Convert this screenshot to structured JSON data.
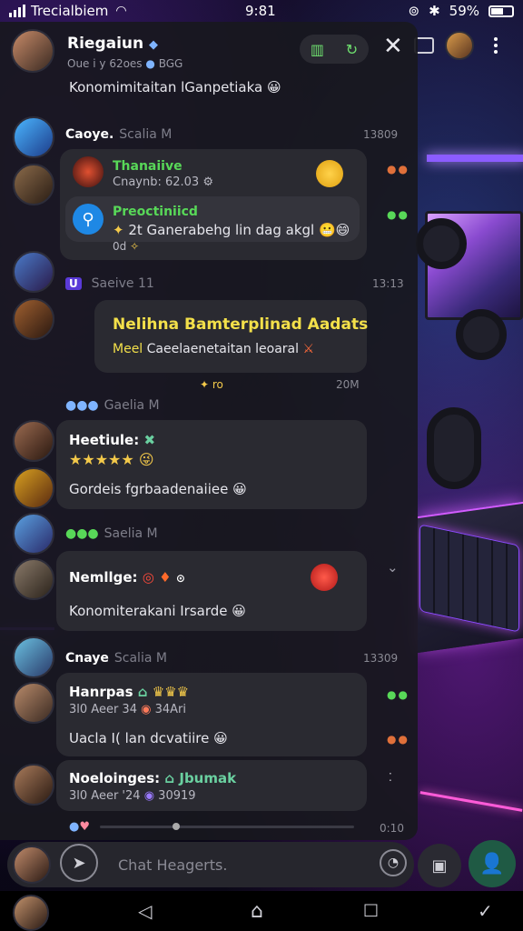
{
  "status_bar": {
    "carrier": "Trecialbiem",
    "time": "9:81",
    "battery": "59%"
  },
  "header": {
    "title": "Riegaiun",
    "subtitle": "Oue i y 62oes",
    "subtitle_tag": "BGG",
    "pinned_message": "Konomimitaitan lGanpetiaka"
  },
  "messages": [
    {
      "sender": "Caoye.",
      "sender_meta": "Scalia M",
      "time": "13809",
      "items": [
        {
          "title": "Thanaiive",
          "detail": "Cnaynb: 62.03"
        },
        {
          "title": "Preoctiniicd",
          "text": "2t Ganerabehg lin dag akgl",
          "reaction": "0d"
        }
      ]
    },
    {
      "sender": "U",
      "sender_meta": "Saeive 11",
      "time": "13:13",
      "headline": "Nelihna Bamterplinad Aadats",
      "body_prefix": "Meel",
      "body": "Caeelaenetaitan leoaral",
      "footer_left": "ro",
      "footer_right": "20M"
    },
    {
      "sender_meta": "Gaelia M",
      "title": "Heetiule:",
      "rating": "★★★★★",
      "text": "Gordeis fgrbaadenaiiee"
    },
    {
      "sender_meta": "Saelia M",
      "title": "Nemllge:",
      "text": "Konomiterakani Irsarde"
    },
    {
      "sender": "Cnaye",
      "sender_meta": "Scalia M",
      "time": "13309",
      "items": [
        {
          "title": "Hanrpas",
          "detail_a": "3l0 Aeer 34",
          "detail_b": "34Ari",
          "text": "Uacla I( lan dcvatiire"
        },
        {
          "title": "Noeloinges:",
          "title_accent": "Jbumak",
          "detail_a": "3l0 Aeer '24",
          "detail_b": "30919"
        }
      ]
    }
  ],
  "playback": {
    "time": "0:10"
  },
  "composer": {
    "placeholder": "Chat Heagerts."
  }
}
